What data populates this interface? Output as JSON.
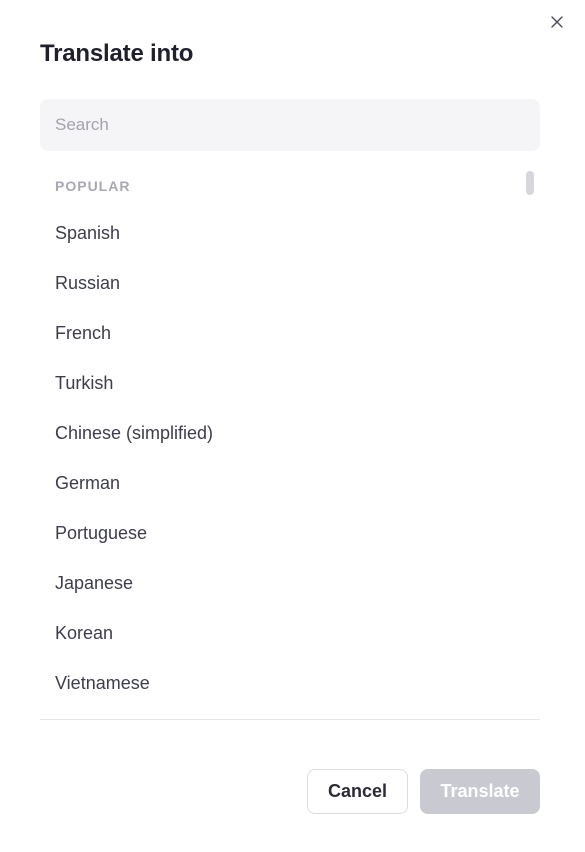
{
  "dialog": {
    "title": "Translate into",
    "close_icon": "close-icon"
  },
  "search": {
    "placeholder": "Search",
    "value": ""
  },
  "list": {
    "section_header": "POPULAR",
    "items": [
      {
        "label": "Spanish"
      },
      {
        "label": "Russian"
      },
      {
        "label": "French"
      },
      {
        "label": "Turkish"
      },
      {
        "label": "Chinese (simplified)"
      },
      {
        "label": "German"
      },
      {
        "label": "Portuguese"
      },
      {
        "label": "Japanese"
      },
      {
        "label": "Korean"
      },
      {
        "label": "Vietnamese"
      }
    ]
  },
  "footer": {
    "cancel_label": "Cancel",
    "translate_label": "Translate"
  },
  "colors": {
    "title": "#1f1f2e",
    "item_text": "#3d3d4d",
    "section_header": "#a8a8b3",
    "search_bg": "#f5f5f7",
    "translate_disabled": "#c9c9d1"
  }
}
